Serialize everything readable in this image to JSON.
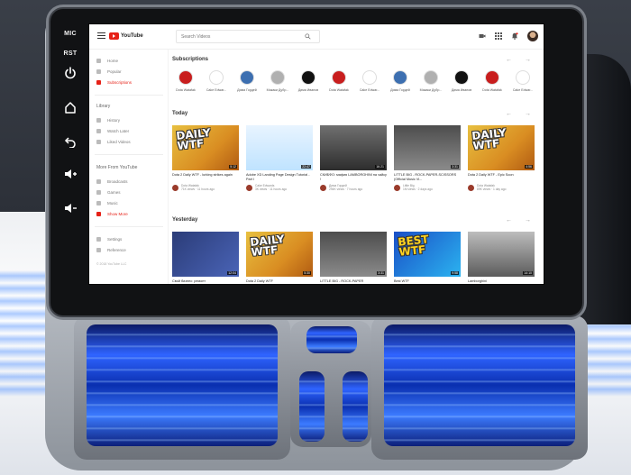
{
  "unit": {
    "side_buttons": [
      {
        "label": "MIC"
      },
      {
        "label": "RST"
      },
      {
        "icon": "power-icon"
      },
      {
        "icon": "home-icon"
      },
      {
        "icon": "back-icon"
      },
      {
        "icon": "volume-up-icon"
      },
      {
        "icon": "volume-down-icon"
      }
    ]
  },
  "topbar": {
    "logo_text": "YouTube",
    "search_placeholder": "Search Videos"
  },
  "sidebar": {
    "nav": [
      {
        "label": "Home"
      },
      {
        "label": "Popular"
      },
      {
        "label": "Subscriptions",
        "active": true
      }
    ],
    "library_heading": "Library",
    "library": [
      {
        "label": "History"
      },
      {
        "label": "Watch Later"
      },
      {
        "label": "Liked Videos"
      }
    ],
    "more_heading": "More From YouTube",
    "more": [
      {
        "label": "Broadcasts"
      },
      {
        "label": "Games"
      },
      {
        "label": "Music"
      },
      {
        "label": "Show More",
        "active": true
      }
    ],
    "footer": [
      {
        "label": "Settings"
      },
      {
        "label": "Reference"
      }
    ],
    "copyright": "© 2018 YouTube LLC"
  },
  "main": {
    "subscriptions_title": "Subscriptions",
    "today_title": "Today",
    "yesterday_title": "Yesterday",
    "arrows": "← →",
    "subscriptions": [
      {
        "name": "Dota Watafak",
        "color": "#c81e1e"
      },
      {
        "name": "Cake Edwar...",
        "color": "#ffffff"
      },
      {
        "name": "Дима Гордей",
        "color": "#3d6fb0"
      },
      {
        "name": "Макаки Дубр...",
        "color": "#b0b0b0"
      },
      {
        "name": "Дима Иванов",
        "color": "#111111"
      },
      {
        "name": "Dota Watafak",
        "color": "#c81e1e"
      },
      {
        "name": "Cake Edwar...",
        "color": "#ffffff"
      },
      {
        "name": "Дима Гордей",
        "color": "#3d6fb0"
      },
      {
        "name": "Макаки Дубр...",
        "color": "#b0b0b0"
      },
      {
        "name": "Дима Иванов",
        "color": "#111111"
      },
      {
        "name": "Dota Watafak",
        "color": "#c81e1e"
      },
      {
        "name": "Cake Edwar...",
        "color": "#ffffff"
      }
    ],
    "today": [
      {
        "thumb": "daily",
        "title": "Dota 2 Daily WTF - lurking strikes again",
        "channel": "Dota Watafak",
        "meta": "71K views · 11 hours ago",
        "duration": "5:12"
      },
      {
        "thumb": "web",
        "title": "Adobe XD Landing Page Design Tutorial - Part I",
        "channel": "Cake Edwards",
        "meta": "3K views · 11 hours ago",
        "duration": "22:47"
      },
      {
        "thumb": "car",
        "title": "СКИБФО: мафия LAMBORGHINI на чайку !",
        "channel": "Дима Гордей",
        "meta": "294K views · 7 hours ago",
        "duration": "16:21"
      },
      {
        "thumb": "crowd",
        "title": "LITTLE BIG - ROCK-PAPER-SCISSORS (Official Music Vi...",
        "channel": "Little Big",
        "meta": "1M views · 2 days ago",
        "duration": "3:31"
      },
      {
        "thumb": "daily",
        "title": "Dota 2 Daily WTF - Epic Soon",
        "channel": "Dota Watafak",
        "meta": "89K views · 1 day ago",
        "duration": "4:56"
      }
    ],
    "yesterday": [
      {
        "thumb": "mech",
        "title": "Свой бизнес: ремонт",
        "duration": "12:04"
      },
      {
        "thumb": "daily",
        "title": "Dota 2 Daily WTF",
        "duration": "5:30"
      },
      {
        "thumb": "crowd",
        "title": "LITTLE BIG - ROCK-PAPER",
        "duration": "3:31"
      },
      {
        "thumb": "best",
        "title": "Best WTF",
        "duration": "9:58"
      },
      {
        "thumb": "car2",
        "title": "Lamborghini",
        "duration": "14:10"
      }
    ]
  },
  "colors": {
    "accent": "#e62117"
  }
}
